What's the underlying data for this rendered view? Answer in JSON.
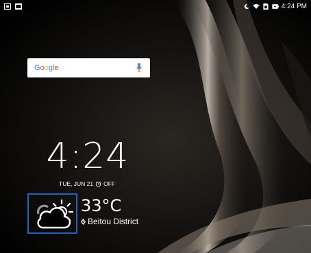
{
  "status_bar": {
    "left_icons": [
      "screenshot-icon",
      "gallery-icon"
    ],
    "right_icons": [
      "moon-icon",
      "wifi-icon",
      "sim-icon",
      "battery-charging-icon"
    ],
    "time": "4:24 PM"
  },
  "search_widget": {
    "logo": "Google",
    "mic_icon": "mic-icon"
  },
  "clock": {
    "time": "4:24",
    "date": "TUE, JUN 21",
    "alarm": "OFF"
  },
  "weather": {
    "temperature": "33°C",
    "location": "Beitou District",
    "icon": "partly-cloudy-icon"
  },
  "colors": {
    "highlight_border": "#1e63c0",
    "google_blue": "#4285f4",
    "google_red": "#ea4335",
    "google_yellow": "#fbbc05",
    "google_green": "#34a853"
  }
}
